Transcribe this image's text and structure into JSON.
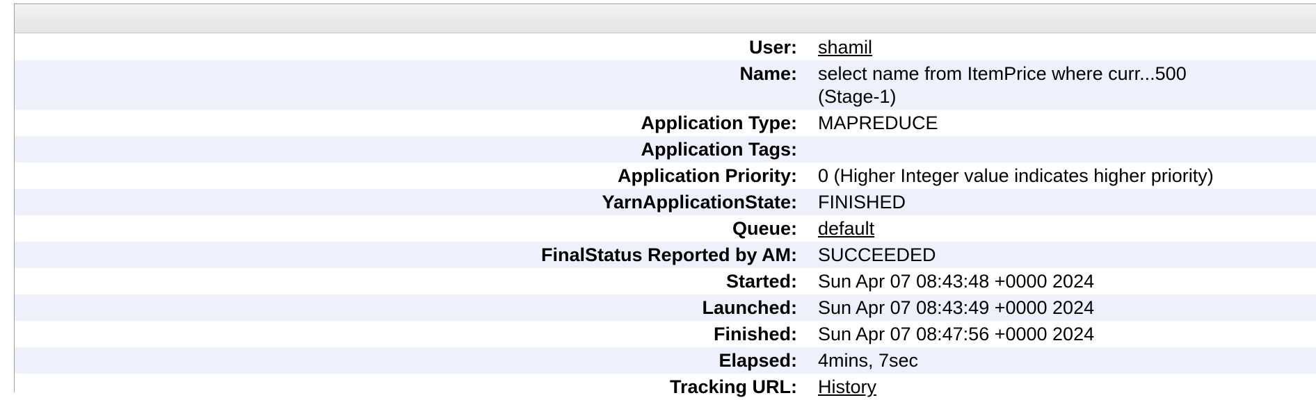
{
  "app_info": {
    "rows": [
      {
        "label": "User:",
        "value": "shamil",
        "link": true
      },
      {
        "label": "Name:",
        "value": "select name from ItemPrice where curr...500 (Stage-1)",
        "link": false
      },
      {
        "label": "Application Type:",
        "value": "MAPREDUCE",
        "link": false
      },
      {
        "label": "Application Tags:",
        "value": "",
        "link": false
      },
      {
        "label": "Application Priority:",
        "value": "0 (Higher Integer value indicates higher priority)",
        "link": false
      },
      {
        "label": "YarnApplicationState:",
        "value": "FINISHED",
        "link": false
      },
      {
        "label": "Queue:",
        "value": "default",
        "link": true
      },
      {
        "label": "FinalStatus Reported by AM:",
        "value": "SUCCEEDED",
        "link": false
      },
      {
        "label": "Started:",
        "value": "Sun Apr 07 08:43:48 +0000 2024",
        "link": false
      },
      {
        "label": "Launched:",
        "value": "Sun Apr 07 08:43:49 +0000 2024",
        "link": false
      },
      {
        "label": "Finished:",
        "value": "Sun Apr 07 08:47:56 +0000 2024",
        "link": false
      },
      {
        "label": "Elapsed:",
        "value": "4mins, 7sec",
        "link": false
      },
      {
        "label": "Tracking URL:",
        "value": "History",
        "link": true
      }
    ]
  }
}
